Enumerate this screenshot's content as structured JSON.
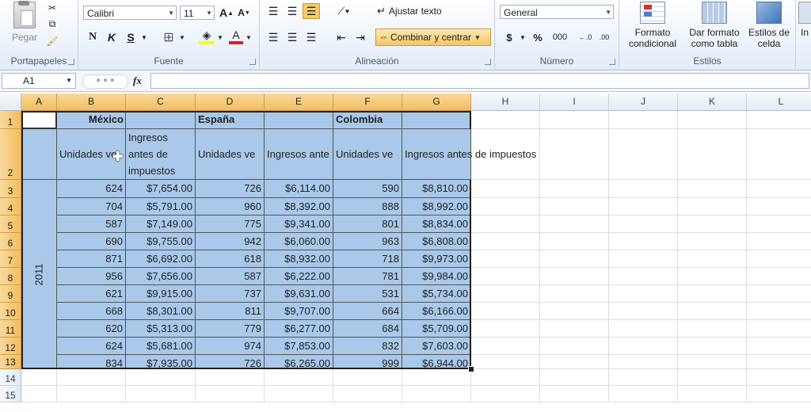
{
  "ribbon": {
    "clipboard": {
      "paste_label": "Pegar",
      "group_label": "Portapapeles"
    },
    "font": {
      "font_name": "Calibri",
      "font_size": "11",
      "group_label": "Fuente",
      "bold": "N",
      "italic": "K",
      "underline": "S"
    },
    "alignment": {
      "wrap_text": "Ajustar texto",
      "merge_center": "Combinar y centrar",
      "group_label": "Alineación"
    },
    "number": {
      "format": "General",
      "currency": "$",
      "percent": "%",
      "thousands": "000",
      "group_label": "Número"
    },
    "styles": {
      "conditional": "Formato\ncondicional",
      "table": "Dar formato\ncomo tabla",
      "cell_styles": "Estilos de\ncelda",
      "group_label": "Estilos"
    },
    "insert_partial": "In"
  },
  "formula_bar": {
    "name_box": "A1",
    "fx": "fx",
    "formula": ""
  },
  "columns": [
    "A",
    "B",
    "C",
    "D",
    "E",
    "F",
    "G",
    "H",
    "I",
    "J",
    "K",
    "L"
  ],
  "rows": [
    "1",
    "2",
    "3",
    "4",
    "5",
    "6",
    "7",
    "8",
    "9",
    "10",
    "11",
    "12",
    "13",
    "14",
    "15"
  ],
  "sheet": {
    "row1": {
      "b": "México",
      "d": "España",
      "f": "Colombia"
    },
    "row2": {
      "b": "Unidades ve",
      "c1": "Ingresos",
      "c2": "antes de",
      "c3": "impuestos",
      "d": "Unidades ve",
      "e": "Ingresos ante",
      "f": "Unidades ve",
      "g": "Ingresos antes de impuestos"
    },
    "year": "2011",
    "data": [
      [
        "624",
        "$7,654.00",
        "726",
        "$6,114.00",
        "590",
        "$8,810.00"
      ],
      [
        "704",
        "$5,791.00",
        "960",
        "$8,392.00",
        "888",
        "$8,992.00"
      ],
      [
        "587",
        "$7,149.00",
        "775",
        "$9,341.00",
        "801",
        "$8,834.00"
      ],
      [
        "690",
        "$9,755.00",
        "942",
        "$6,060.00",
        "963",
        "$6,808.00"
      ],
      [
        "871",
        "$6,692.00",
        "618",
        "$8,932.00",
        "718",
        "$9,973.00"
      ],
      [
        "956",
        "$7,656.00",
        "587",
        "$6,222.00",
        "781",
        "$9,984.00"
      ],
      [
        "621",
        "$9,915.00",
        "737",
        "$9,631.00",
        "531",
        "$5,734.00"
      ],
      [
        "668",
        "$8,301.00",
        "811",
        "$9,707.00",
        "664",
        "$6,166.00"
      ],
      [
        "620",
        "$5,313.00",
        "779",
        "$6,277.00",
        "684",
        "$5,709.00"
      ],
      [
        "624",
        "$5,681.00",
        "974",
        "$7,853.00",
        "832",
        "$7,603.00"
      ],
      [
        "834",
        "$7,935.00",
        "726",
        "$6,265.00",
        "999",
        "$6,944.00"
      ]
    ]
  }
}
